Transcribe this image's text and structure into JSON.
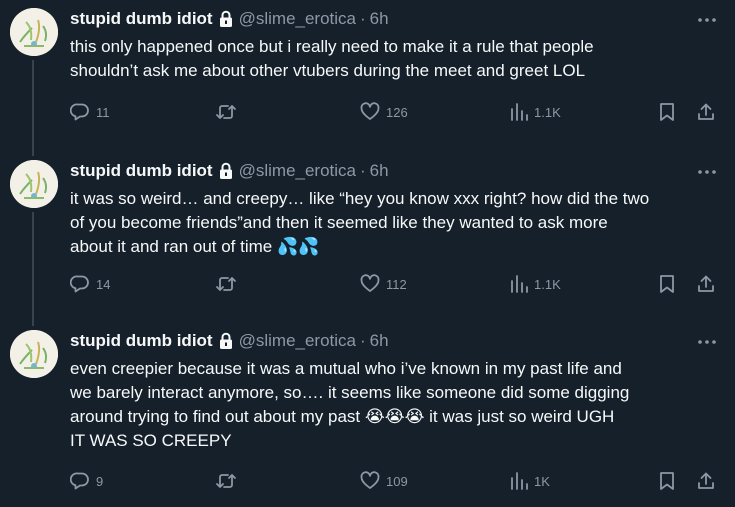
{
  "colors": {
    "background": "#15202b",
    "text": "#f7f9f9",
    "muted": "#8b98a5",
    "divider": "#38444d"
  },
  "tweets": [
    {
      "name": "stupid dumb idiot",
      "handle": "@slime_erotica",
      "dot": "·",
      "time": "6h",
      "text": "this only happened once but i really need to make it a rule that people\nshouldn’t ask me about other vtubers during the meet and greet LOL",
      "emoji": "",
      "stats": {
        "replies": "11",
        "retweets": "",
        "likes": "126",
        "views": "1.1K"
      }
    },
    {
      "name": "stupid dumb idiot",
      "handle": "@slime_erotica",
      "dot": "·",
      "time": "6h",
      "text": "it was so weird… and creepy… like “hey you know xxx right? how did the two\nof you become friends”and then it seemed like they wanted to ask more\nabout it and ran out of time ",
      "emoji": "💦💦",
      "stats": {
        "replies": "14",
        "retweets": "",
        "likes": "112",
        "views": "1.1K"
      }
    },
    {
      "name": "stupid dumb idiot",
      "handle": "@slime_erotica",
      "dot": "·",
      "time": "6h",
      "text": "even creepier because it was a mutual who i’ve known in my past life and\nwe barely interact anymore, so…. it seems like someone did some digging\naround trying to find out about my past 😭😭😭 it was just so weird UGH\nIT WAS SO CREEPY",
      "emoji": "",
      "stats": {
        "replies": "9",
        "retweets": "",
        "likes": "109",
        "views": "1K"
      }
    }
  ],
  "icons": {
    "reply": "reply-icon",
    "retweet": "retweet-icon",
    "like": "heart-icon",
    "views": "views-icon",
    "bookmark": "bookmark-icon",
    "share": "share-icon",
    "lock": "lock-icon",
    "more": "more-icon"
  }
}
